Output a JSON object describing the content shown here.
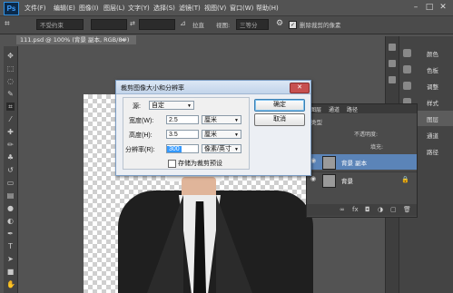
{
  "app": {
    "logo": "Ps",
    "menu": [
      "文件(F)",
      "编辑(E)",
      "图像(I)",
      "图层(L)",
      "文字(Y)",
      "选择(S)",
      "滤镜(T)",
      "视图(V)",
      "窗口(W)",
      "帮助(H)"
    ],
    "window_controls": [
      "–",
      "□",
      "✕"
    ]
  },
  "options_bar": {
    "preset": "不受约束",
    "rotate_label": "拉直",
    "view_label": "视图:",
    "view_value": "三等分",
    "delete_cropped_label": "删除裁剪的像素"
  },
  "document_tab": {
    "title": "111.psd @ 100% (背景 副本, RGB/8#)",
    "close": "×"
  },
  "right_panel": {
    "items": [
      {
        "label": "颜色",
        "icon": "color-icon"
      },
      {
        "label": "色板",
        "icon": "swatches-icon"
      },
      {
        "label": "调整",
        "icon": "adjustments-icon"
      },
      {
        "label": "样式",
        "icon": "styles-icon"
      },
      {
        "label": "图层",
        "icon": "layers-icon"
      },
      {
        "label": "通道",
        "icon": "channels-icon"
      },
      {
        "label": "路径",
        "icon": "paths-icon"
      }
    ]
  },
  "layers_panel": {
    "tabs": [
      "图层",
      "通道",
      "路径"
    ],
    "kind": "类型",
    "opacity_label": "不透明度:",
    "fill_label": "填充:",
    "layers": [
      {
        "name": "背景 副本",
        "selected": true
      },
      {
        "name": "背景",
        "selected": false
      }
    ]
  },
  "dialog": {
    "title": "裁剪图像大小和分辨率",
    "close": "✕",
    "source_label": "源:",
    "source_value": "自定",
    "width_label": "宽度(W):",
    "width_value": "2.5",
    "width_unit": "厘米",
    "height_label": "高度(H):",
    "height_value": "3.5",
    "height_unit": "厘米",
    "resolution_label": "分辨率(R):",
    "resolution_value": "300",
    "resolution_unit": "像素/英寸",
    "save_preset_label": "存储为裁剪预设",
    "ok_label": "确定",
    "cancel_label": "取消"
  },
  "colors": {
    "ui_bg": "#535353",
    "selected_layer": "#5b84b8",
    "dialog_bg": "#eceff4"
  }
}
